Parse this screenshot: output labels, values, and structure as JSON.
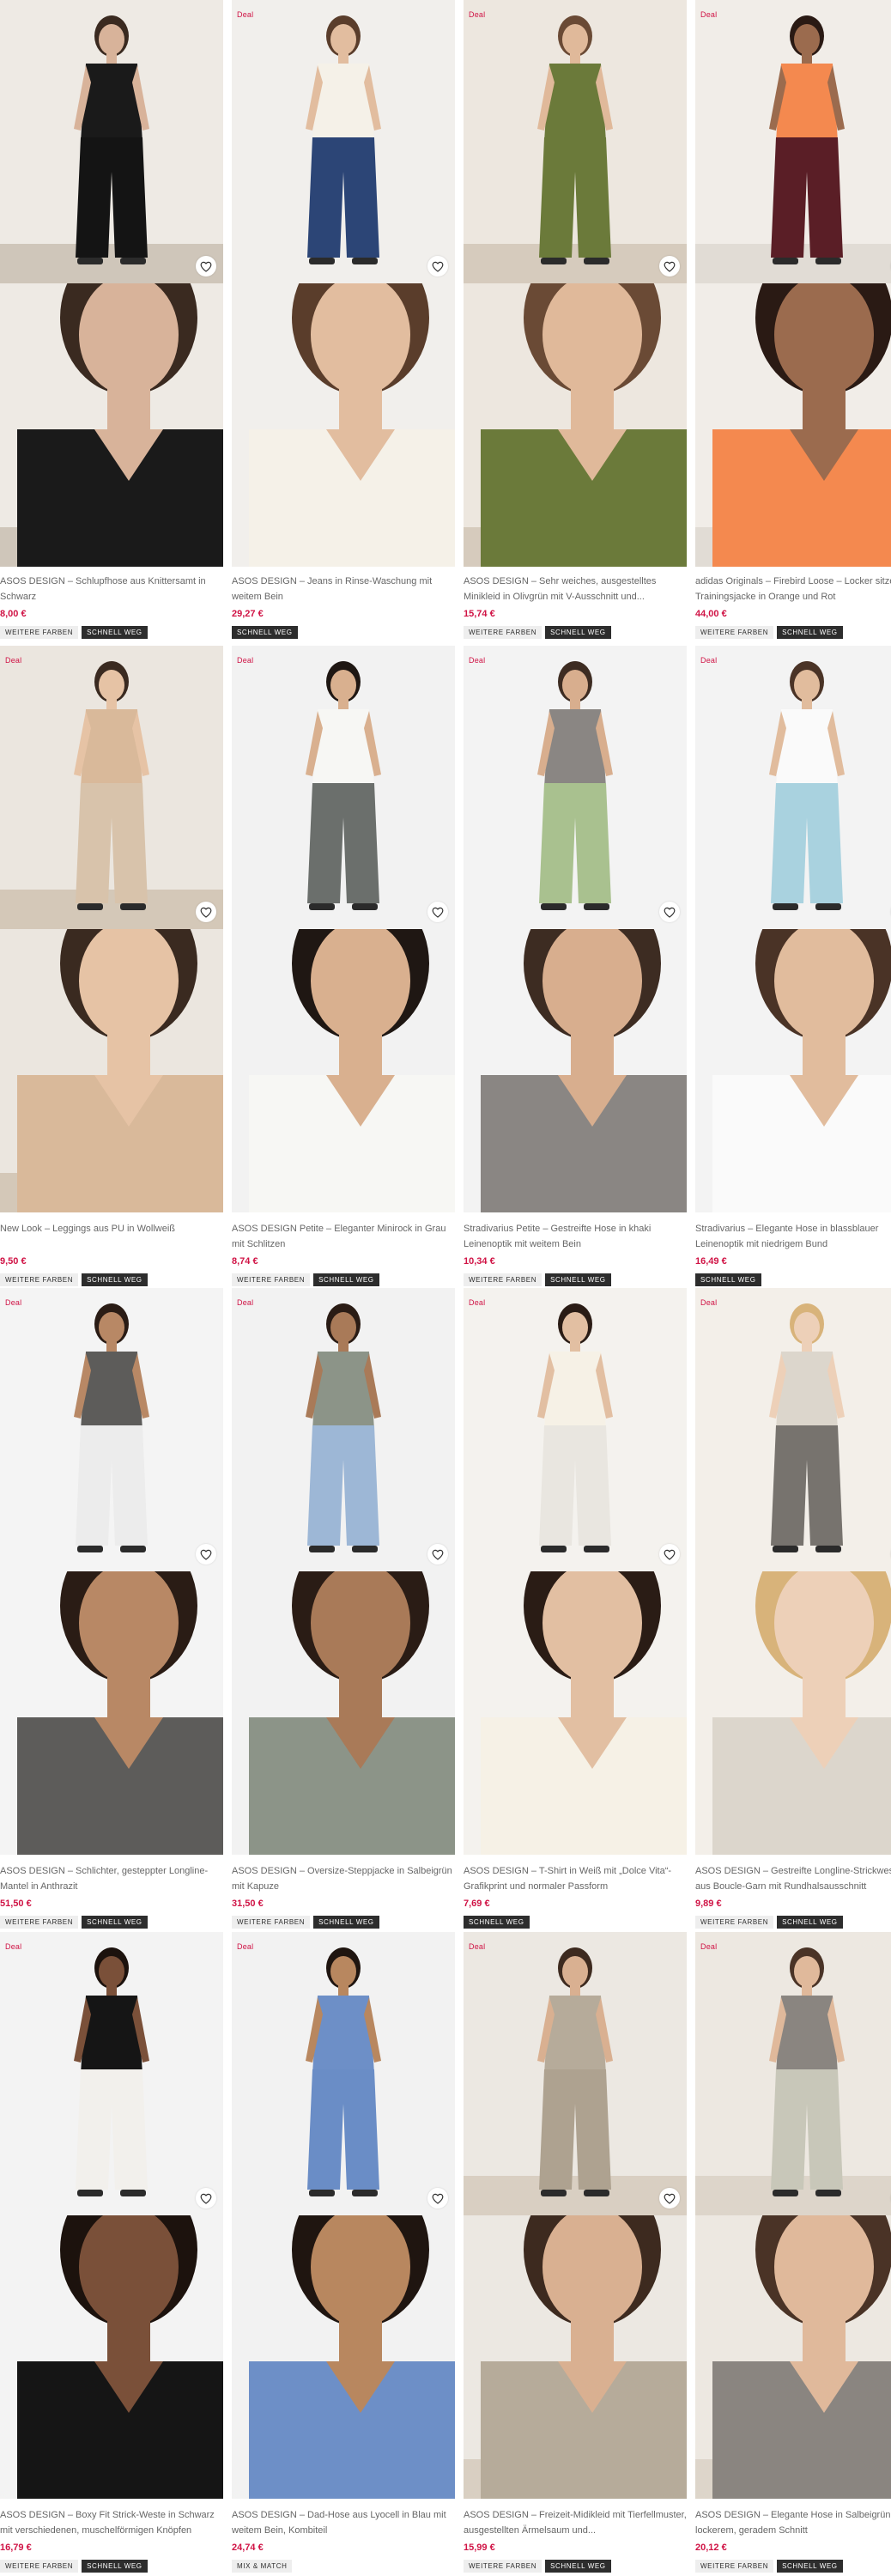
{
  "deal_label": "Deal",
  "products": [
    {
      "name": "ASOS DESIGN – Schlupfhose aus Knittersamt in Schwarz",
      "price": "8,00 €",
      "badges": [
        "WEITERE FARBEN",
        "SCHNELL WEG"
      ],
      "deal": false,
      "colors": {
        "wall": "#eeeae4",
        "floor": "#cfc6ba",
        "top": "#1a1a1a",
        "bottom": "#141414",
        "skin": "#d8b39a",
        "hair": "#3a2a20"
      }
    },
    {
      "name": "ASOS DESIGN – Jeans in Rinse-Waschung mit weitem Bein",
      "price": "29,27 €",
      "badges": [
        "SCHNELL WEG"
      ],
      "deal": true,
      "colors": {
        "wall": "#f1efec",
        "floor": "#f1efec",
        "top": "#f5f1e8",
        "bottom": "#2c4576",
        "skin": "#e2bd9f",
        "hair": "#5a3d2b"
      }
    },
    {
      "name": "ASOS DESIGN – Sehr weiches, ausgestelltes Minikleid in Olivgrün mit V-Ausschnitt und...",
      "price": "15,74 €",
      "badges": [
        "WEITERE FARBEN",
        "SCHNELL WEG"
      ],
      "deal": true,
      "colors": {
        "wall": "#ede7df",
        "floor": "#d6cbbd",
        "top": "#6b7a3a",
        "bottom": "#6b7a3a",
        "skin": "#e0b99a",
        "hair": "#6a4a35"
      }
    },
    {
      "name": "adidas Originals – Firebird Loose – Locker sitzende Trainingsjacke in Orange und Rot",
      "price": "44,00 €",
      "badges": [
        "WEITERE FARBEN",
        "SCHNELL WEG"
      ],
      "deal": true,
      "colors": {
        "wall": "#f1ede8",
        "floor": "#e1dcd5",
        "top": "#f4894f",
        "bottom": "#5a1e26",
        "skin": "#9b6b4e",
        "hair": "#2a1a14"
      }
    },
    {
      "name": "New Look – Leggings aus PU in Wollweiß",
      "price": "9,50 €",
      "badges": [
        "WEITERE FARBEN",
        "SCHNELL WEG"
      ],
      "deal": true,
      "colors": {
        "wall": "#ebe6df",
        "floor": "#d4c8b8",
        "top": "#d9b99a",
        "bottom": "#d8c3ab",
        "skin": "#e6c3a5",
        "hair": "#3a2a20"
      }
    },
    {
      "name": "ASOS DESIGN Petite – Eleganter Minirock in Grau mit Schlitzen",
      "price": "8,74 €",
      "badges": [
        "WEITERE FARBEN",
        "SCHNELL WEG"
      ],
      "deal": true,
      "colors": {
        "wall": "#f2f2f2",
        "floor": "#f2f2f2",
        "top": "#f7f7f4",
        "bottom": "#6b6f6c",
        "skin": "#d9b08f",
        "hair": "#1f1713"
      }
    },
    {
      "name": "Stradivarius Petite – Gestreifte Hose in khaki Leinenoptik mit weitem Bein",
      "price": "10,34 €",
      "badges": [
        "WEITERE FARBEN",
        "SCHNELL WEG"
      ],
      "deal": true,
      "colors": {
        "wall": "#f3f3f3",
        "floor": "#f3f3f3",
        "top": "#8a8683",
        "bottom": "#a9c18f",
        "skin": "#d8ae8e",
        "hair": "#3d2c22"
      }
    },
    {
      "name": "Stradivarius – Elegante Hose in blassblauer Leinenoptik mit niedrigem Bund",
      "price": "16,49 €",
      "badges": [
        "SCHNELL WEG"
      ],
      "deal": true,
      "colors": {
        "wall": "#f3f3f3",
        "floor": "#f3f3f3",
        "top": "#fafafa",
        "bottom": "#a9d2df",
        "skin": "#e1bc9d",
        "hair": "#4a3326"
      }
    },
    {
      "name": "ASOS DESIGN – Schlichter, gesteppter Longline-Mantel in Anthrazit",
      "price": "51,50 €",
      "badges": [
        "WEITERE FARBEN",
        "SCHNELL WEG"
      ],
      "deal": true,
      "colors": {
        "wall": "#f4f4f4",
        "floor": "#f4f4f4",
        "top": "#5d5c5a",
        "bottom": "#ececec",
        "skin": "#b88865",
        "hair": "#2a1c15"
      }
    },
    {
      "name": "ASOS DESIGN – Oversize-Steppjacke in Salbeigrün mit Kapuze",
      "price": "31,50 €",
      "badges": [
        "WEITERE FARBEN",
        "SCHNELL WEG"
      ],
      "deal": true,
      "colors": {
        "wall": "#f2f2f2",
        "floor": "#f2f2f2",
        "top": "#8c9488",
        "bottom": "#9db7d6",
        "skin": "#a97a58",
        "hair": "#2a1c15"
      }
    },
    {
      "name": "ASOS DESIGN – T-Shirt in Weiß mit „Dolce Vita“-Grafikprint und normaler Passform",
      "price": "7,69 €",
      "badges": [
        "SCHNELL WEG"
      ],
      "deal": true,
      "colors": {
        "wall": "#f4f2ee",
        "floor": "#f4f2ee",
        "top": "#f6f1e6",
        "bottom": "#e9e6e0",
        "skin": "#e2bfa2",
        "hair": "#2a1c15"
      }
    },
    {
      "name": "ASOS DESIGN – Gestreifte Longline-Strickweste aus Boucle-Garn mit Rundhalsausschnitt",
      "price": "9,89 €",
      "badges": [
        "WEITERE FARBEN",
        "SCHNELL WEG"
      ],
      "deal": true,
      "colors": {
        "wall": "#f3efe9",
        "floor": "#f3efe9",
        "top": "#dcd6cc",
        "bottom": "#77736e",
        "skin": "#edd0b8",
        "hair": "#d8b37a"
      }
    },
    {
      "name": "ASOS DESIGN – Boxy Fit Strick-Weste in Schwarz mit verschiedenen, muschelförmigen Knöpfen",
      "price": "16,79 €",
      "badges": [
        "WEITERE FARBEN",
        "SCHNELL WEG"
      ],
      "deal": true,
      "colors": {
        "wall": "#f3f3f3",
        "floor": "#f3f3f3",
        "top": "#151515",
        "bottom": "#f2f0ec",
        "skin": "#7a5039",
        "hair": "#1c120d"
      }
    },
    {
      "name": "ASOS DESIGN – Dad-Hose aus Lyocell in Blau mit weitem Bein, Kombiteil",
      "price": "24,74 €",
      "badges": [
        "MIX & MATCH"
      ],
      "deal": true,
      "colors": {
        "wall": "#f2f2f2",
        "floor": "#f2f2f2",
        "top": "#6d8fc7",
        "bottom": "#6a8dc6",
        "skin": "#b8875f",
        "hair": "#1f1510"
      }
    },
    {
      "name": "ASOS DESIGN – Freizeit-Midikleid mit Tierfellmuster, ausgestellten Ärmelsaum und...",
      "price": "15,99 €",
      "badges": [
        "WEITERE FARBEN",
        "SCHNELL WEG"
      ],
      "deal": true,
      "colors": {
        "wall": "#ece8e2",
        "floor": "#d9cfc2",
        "top": "#b6ab9a",
        "bottom": "#aea290",
        "skin": "#d9b091",
        "hair": "#3d2a1f"
      }
    },
    {
      "name": "ASOS DESIGN – Elegante Hose in Salbeigrün in lockerem, geradem Schnitt",
      "price": "20,12 €",
      "badges": [
        "WEITERE FARBEN",
        "SCHNELL WEG"
      ],
      "deal": true,
      "colors": {
        "wall": "#ede8e1",
        "floor": "#ddd5ca",
        "top": "#8a8580",
        "bottom": "#c8c7b9",
        "skin": "#e0b99b",
        "hair": "#4a3326"
      }
    }
  ]
}
